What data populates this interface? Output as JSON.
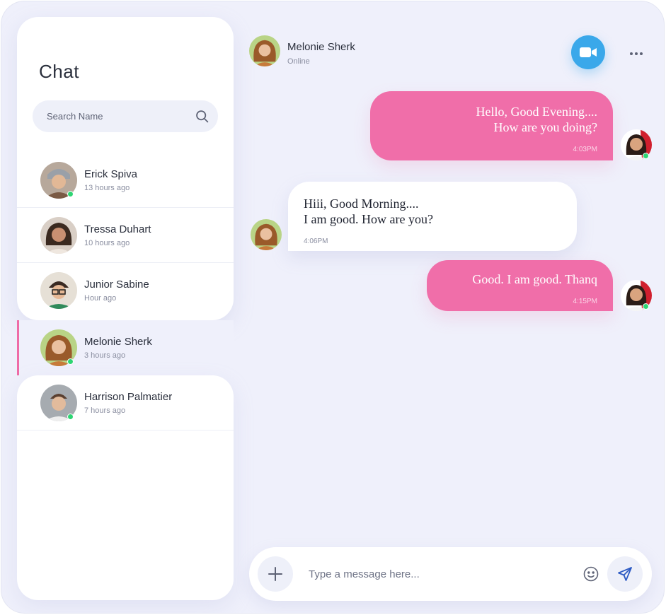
{
  "sidebar": {
    "title": "Chat",
    "search": {
      "placeholder": "Search Name",
      "value": ""
    },
    "contacts": [
      {
        "name": "Erick Spiva",
        "time": "13 hours ago",
        "online": true,
        "active": false,
        "avatar_color": "#8a6a55"
      },
      {
        "name": "Tressa Duhart",
        "time": "10 hours ago",
        "online": false,
        "active": false,
        "avatar_color": "#4a3328"
      },
      {
        "name": "Junior Sabine",
        "time": "Hour ago",
        "online": false,
        "active": false,
        "avatar_color": "#3a7a55"
      },
      {
        "name": "Melonie Sherk",
        "time": "3 hours ago",
        "online": true,
        "active": true,
        "avatar_color": "#b06a35"
      },
      {
        "name": "Harrison Palmatier",
        "time": "7 hours ago",
        "online": true,
        "active": false,
        "avatar_color": "#6b6e73"
      }
    ]
  },
  "chat": {
    "contact_name": "Melonie Sherk",
    "status": "Online",
    "messages": [
      {
        "direction": "outgoing",
        "text": "Hello, Good Evening....\nHow are you doing?",
        "time": "4:03PM"
      },
      {
        "direction": "incoming",
        "text": "Hiii, Good Morning....\nI am good. How are you?",
        "time": "4:06PM"
      },
      {
        "direction": "outgoing",
        "text": "Good. I am good. Thanq",
        "time": "4:15PM"
      }
    ]
  },
  "composer": {
    "placeholder": "Type a message here...",
    "value": ""
  },
  "colors": {
    "accent_pink": "#f06ea9",
    "video_blue": "#3aa8ea",
    "online_green": "#2ed573",
    "background": "#eff0fb"
  },
  "icons": {
    "search": "search-icon",
    "video": "video-camera-icon",
    "more": "more-horizontal-icon",
    "plus": "plus-icon",
    "emoji": "smiley-icon",
    "send": "paper-plane-icon"
  }
}
